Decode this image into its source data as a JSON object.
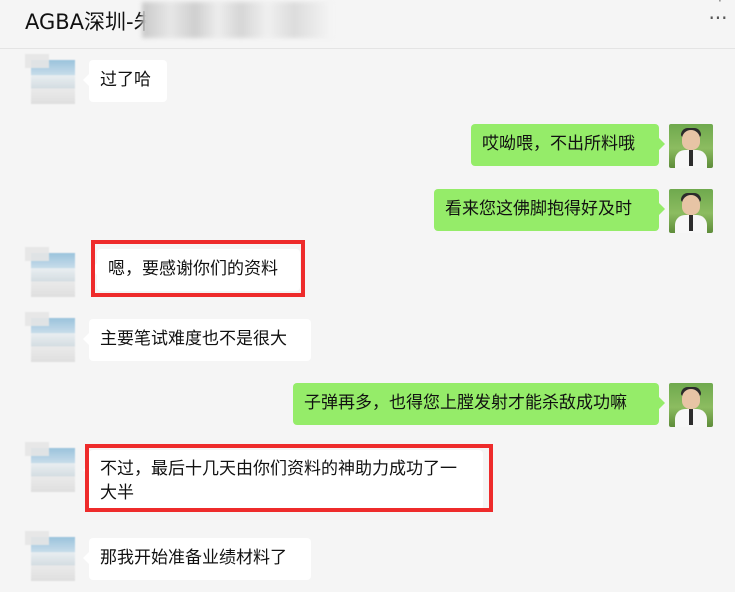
{
  "header": {
    "title": "AGBA深圳-朱",
    "more_icon": "more-dots-icon",
    "more_label": "···"
  },
  "messages": [
    {
      "side": "left",
      "text": "过了哈",
      "highlighted": false
    },
    {
      "side": "right",
      "text": "哎呦喂，不出所料哦",
      "highlighted": false
    },
    {
      "side": "right",
      "text": "看来您这佛脚抱得好及时",
      "highlighted": false
    },
    {
      "side": "left",
      "text": "嗯，要感谢你们的资料",
      "highlighted": true
    },
    {
      "side": "left",
      "text": "主要笔试难度也不是很大",
      "highlighted": false
    },
    {
      "side": "right",
      "text": "子弹再多，也得您上膛发射才能杀敌成功嘛",
      "highlighted": false
    },
    {
      "side": "left",
      "text": "不过，最后十几天由你们资料的神助力成功了一大半",
      "highlighted": true
    },
    {
      "side": "left",
      "text": "那我开始准备业绩材料了",
      "highlighted": false
    }
  ],
  "colors": {
    "background": "#f5f5f5",
    "bubble_self": "#95ec69",
    "bubble_other": "#ffffff",
    "highlight": "#ee2b2b"
  }
}
